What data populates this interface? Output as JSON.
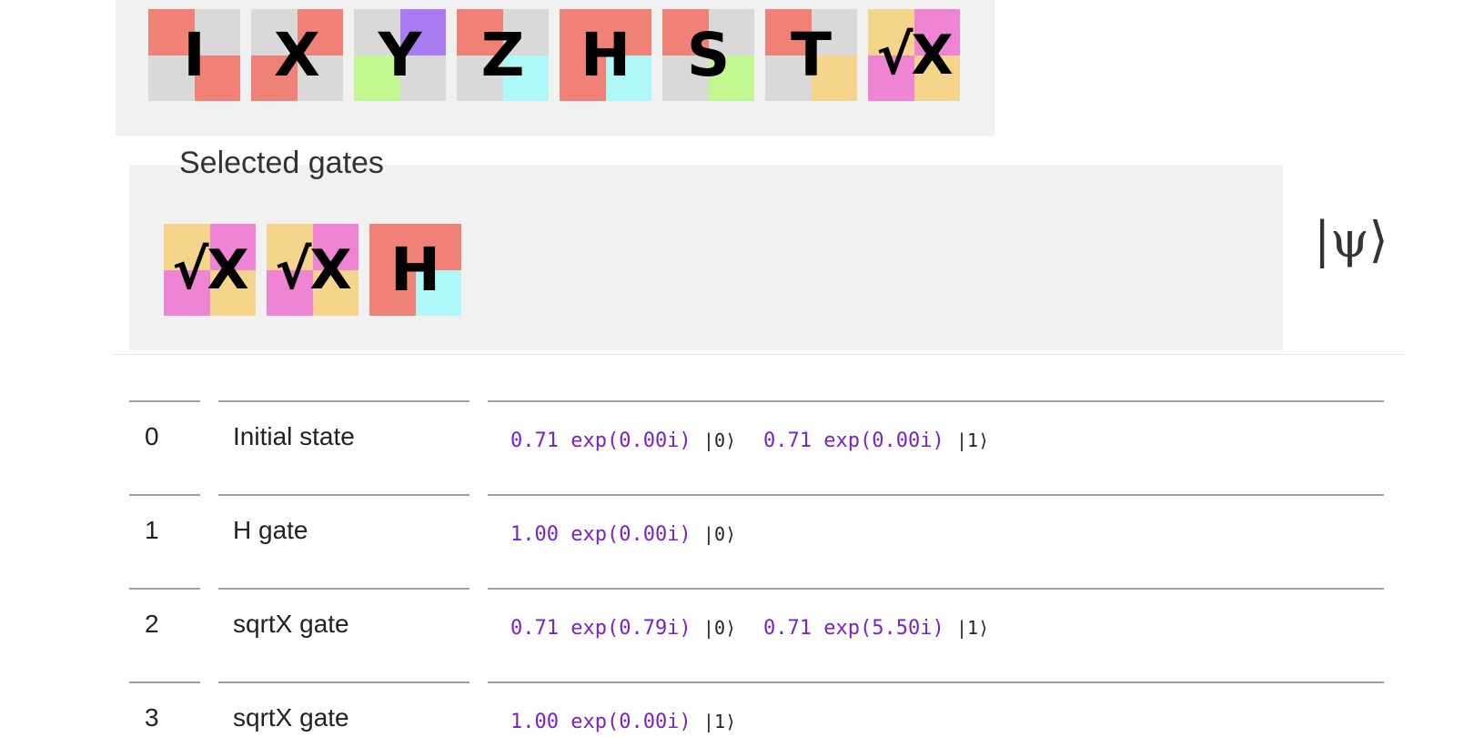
{
  "colors": {
    "red": "#ef8176",
    "gray": "#d9d9d9",
    "purple": "#a97cf2",
    "green": "#c3f791",
    "cyan": "#aef8f7",
    "yellow": "#f5d48c",
    "pink": "#ef84d5",
    "amplitude": "#7b22c4",
    "panel": "#f1f1f1"
  },
  "palette": [
    {
      "label": "I",
      "quads": [
        "red",
        "gray",
        "gray",
        "red"
      ]
    },
    {
      "label": "X",
      "quads": [
        "gray",
        "red",
        "red",
        "gray"
      ]
    },
    {
      "label": "Y",
      "quads": [
        "gray",
        "purple",
        "green",
        "gray"
      ]
    },
    {
      "label": "Z",
      "quads": [
        "red",
        "gray",
        "gray",
        "cyan"
      ]
    },
    {
      "label": "H",
      "quads": [
        "red",
        "red",
        "red",
        "cyan"
      ]
    },
    {
      "label": "S",
      "quads": [
        "red",
        "gray",
        "gray",
        "green"
      ]
    },
    {
      "label": "T",
      "quads": [
        "red",
        "gray",
        "gray",
        "yellow"
      ]
    },
    {
      "label": "√X",
      "quads": [
        "yellow",
        "pink",
        "pink",
        "yellow"
      ]
    }
  ],
  "selected": {
    "title": "Selected gates",
    "gates": [
      {
        "label": "√X",
        "quads": [
          "yellow",
          "pink",
          "pink",
          "yellow"
        ]
      },
      {
        "label": "√X",
        "quads": [
          "yellow",
          "pink",
          "pink",
          "yellow"
        ]
      },
      {
        "label": "H",
        "quads": [
          "red",
          "red",
          "red",
          "cyan"
        ]
      }
    ]
  },
  "psi_symbol": "|ψ⟩",
  "steps": [
    {
      "index": "0",
      "name": "Initial state",
      "terms": [
        {
          "amp": "0.71 exp(0.00i)",
          "ket": "|0⟩"
        },
        {
          "amp": "0.71 exp(0.00i)",
          "ket": "|1⟩"
        }
      ]
    },
    {
      "index": "1",
      "name": "H gate",
      "terms": [
        {
          "amp": "1.00 exp(0.00i)",
          "ket": "|0⟩"
        }
      ]
    },
    {
      "index": "2",
      "name": "sqrtX gate",
      "terms": [
        {
          "amp": "0.71 exp(0.79i)",
          "ket": "|0⟩"
        },
        {
          "amp": "0.71 exp(5.50i)",
          "ket": "|1⟩"
        }
      ]
    },
    {
      "index": "3",
      "name": "sqrtX gate",
      "terms": [
        {
          "amp": "1.00 exp(0.00i)",
          "ket": "|1⟩"
        }
      ]
    }
  ]
}
